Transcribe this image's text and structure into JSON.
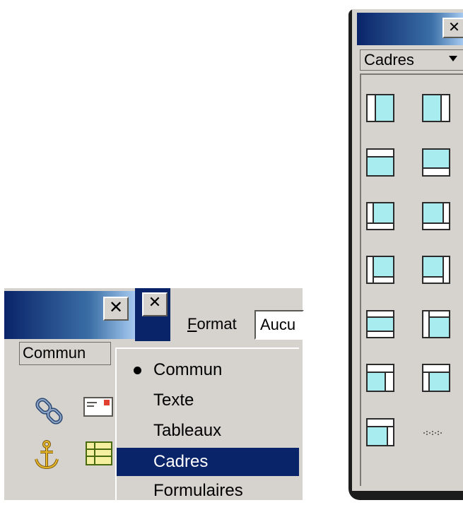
{
  "left_palette": {
    "close_glyph": "✕",
    "close_glyph_2": "✕",
    "category": "Commun",
    "icons": [
      "hyperlink-icon",
      "email-link-icon",
      "named-anchor-icon",
      "table-icon"
    ]
  },
  "format_bar": {
    "label_rest": "ormat",
    "label_underlined": "F",
    "field_value": "Aucu"
  },
  "category_menu": {
    "items": [
      {
        "label": "Commun",
        "checked": true,
        "selected": false
      },
      {
        "label": "Texte",
        "checked": false,
        "selected": false
      },
      {
        "label": "Tableaux",
        "checked": false,
        "selected": false
      },
      {
        "label": "Cadres",
        "checked": false,
        "selected": true
      },
      {
        "label": "Formulaires",
        "checked": false,
        "selected": false
      }
    ]
  },
  "right_palette": {
    "close_glyph": "✕",
    "category": "Cadres",
    "frame_icons": [
      "left-frame-icon",
      "right-frame-icon",
      "top-frame-icon",
      "bottom-frame-icon",
      "bottom-nested-left-frame-icon",
      "bottom-nested-right-frame-icon",
      "left-nested-bottom-frame-icon",
      "right-nested-bottom-frame-icon",
      "top-and-bottom-frames-icon",
      "left-nested-top-frame-icon",
      "right-nested-top-frame-icon",
      "top-nested-left-frame-icon",
      "top-nested-right-frame-icon",
      "frames-more-icon"
    ]
  },
  "colors": {
    "title_bar": "#0a246a",
    "selection": "#0a246a",
    "face": "#d6d3ce",
    "frame_fill": "#a8ecef"
  }
}
